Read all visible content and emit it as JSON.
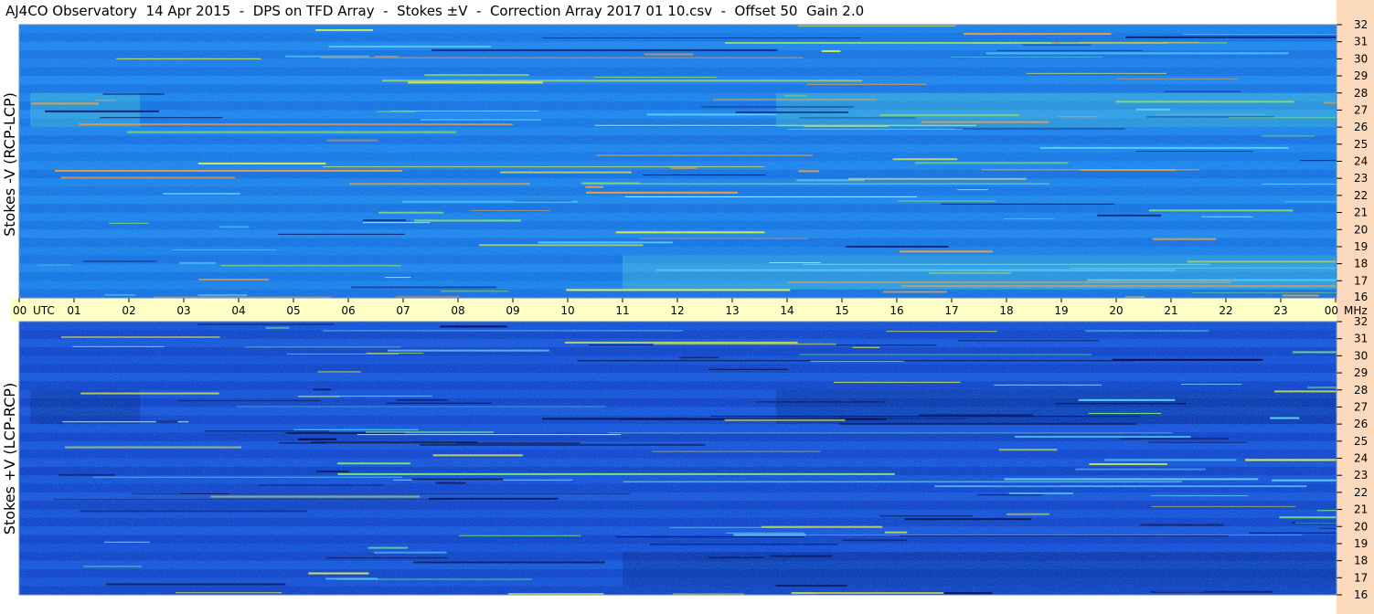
{
  "title": "AJ4CO Observatory  14 Apr 2015  -  DPS on TFD Array  -  Stokes ±V  -  Correction Array 2017 01 10.csv  -  Offset 50  Gain 2.0",
  "colors": {
    "axis_band": "#ffffc8",
    "mhz_band": "#fbd9bd",
    "panel_top": "#1e7ee8",
    "panel_bottom": "#1a4fd6"
  },
  "chart_data": [
    {
      "type": "heatmap",
      "ylabel": "Stokes -V (RCP-LCP)",
      "x_unit": "UTC",
      "y_unit": "MHz",
      "xlim": [
        0,
        24
      ],
      "ylim": [
        16,
        32
      ],
      "x_ticks": [
        "00",
        "01",
        "02",
        "03",
        "04",
        "05",
        "06",
        "07",
        "08",
        "09",
        "10",
        "11",
        "12",
        "13",
        "14",
        "15",
        "16",
        "17",
        "18",
        "19",
        "20",
        "21",
        "22",
        "23",
        "00"
      ],
      "y_ticks": [
        "16",
        "17",
        "18",
        "19",
        "20",
        "21",
        "22",
        "23",
        "24",
        "25",
        "26",
        "27",
        "28",
        "29",
        "30",
        "31",
        "32"
      ],
      "activity_bands": [
        {
          "utc_start": 0.2,
          "utc_end": 2.2,
          "mhz_low": 26,
          "mhz_high": 28
        },
        {
          "utc_start": 13.8,
          "utc_end": 24,
          "mhz_low": 26,
          "mhz_high": 28
        },
        {
          "utc_start": 11,
          "utc_end": 24,
          "mhz_low": 16.5,
          "mhz_high": 18.5
        }
      ]
    },
    {
      "type": "heatmap",
      "ylabel": "Stokes +V (LCP-RCP)",
      "x_unit": "UTC",
      "y_unit": "MHz",
      "xlim": [
        0,
        24
      ],
      "ylim": [
        16,
        32
      ],
      "y_ticks": [
        "16",
        "17",
        "18",
        "19",
        "20",
        "21",
        "22",
        "23",
        "24",
        "25",
        "26",
        "27",
        "28",
        "29",
        "30",
        "31",
        "32"
      ],
      "activity_bands": [
        {
          "utc_start": 0.2,
          "utc_end": 2.2,
          "mhz_low": 26,
          "mhz_high": 28
        },
        {
          "utc_start": 13.8,
          "utc_end": 24,
          "mhz_low": 26,
          "mhz_high": 28
        },
        {
          "utc_start": 11,
          "utc_end": 24,
          "mhz_low": 16.5,
          "mhz_high": 18.5
        }
      ]
    }
  ]
}
